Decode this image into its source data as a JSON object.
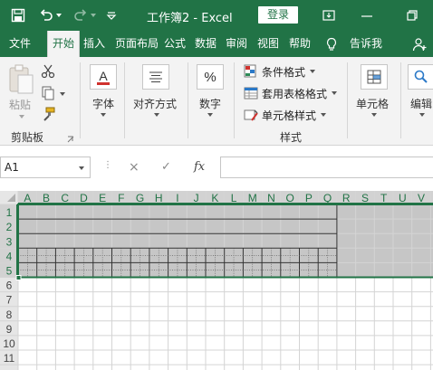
{
  "titlebar": {
    "title": "工作簿2 - Excel",
    "login_label": "登录",
    "bg_color": "#217346"
  },
  "tabs": [
    {
      "label": "文件"
    },
    {
      "label": "开始"
    },
    {
      "label": "插入"
    },
    {
      "label": "页面布局"
    },
    {
      "label": "公式"
    },
    {
      "label": "数据"
    },
    {
      "label": "审阅"
    },
    {
      "label": "视图"
    },
    {
      "label": "帮助"
    },
    {
      "label": "告诉我"
    }
  ],
  "ribbon": {
    "clipboard": {
      "paste": "粘贴",
      "group": "剪贴板"
    },
    "font": {
      "label": "字体",
      "icon_letter": "A"
    },
    "align": {
      "label": "对齐方式"
    },
    "number": {
      "label": "数字",
      "icon_symbol": "%"
    },
    "styles": {
      "conditional": "条件格式",
      "table": "套用表格格式",
      "cell_styles": "单元格样式",
      "group": "样式"
    },
    "cells": {
      "label": "单元格"
    },
    "edit": {
      "label": "编辑"
    }
  },
  "formula_bar": {
    "name_box": "A1",
    "cancel_symbol": "×",
    "enter_symbol": "✓",
    "fx_symbol": "fx",
    "value": ""
  },
  "sheet": {
    "columns": [
      "A",
      "B",
      "C",
      "D",
      "E",
      "F",
      "G",
      "H",
      "I",
      "J",
      "K",
      "L",
      "M",
      "N",
      "O",
      "P",
      "Q",
      "R",
      "S",
      "T",
      "U",
      "V"
    ],
    "rows": [
      "1",
      "2",
      "3",
      "4",
      "5",
      "6",
      "7",
      "8",
      "9",
      "10",
      "11"
    ],
    "selection": "A1:V5"
  }
}
